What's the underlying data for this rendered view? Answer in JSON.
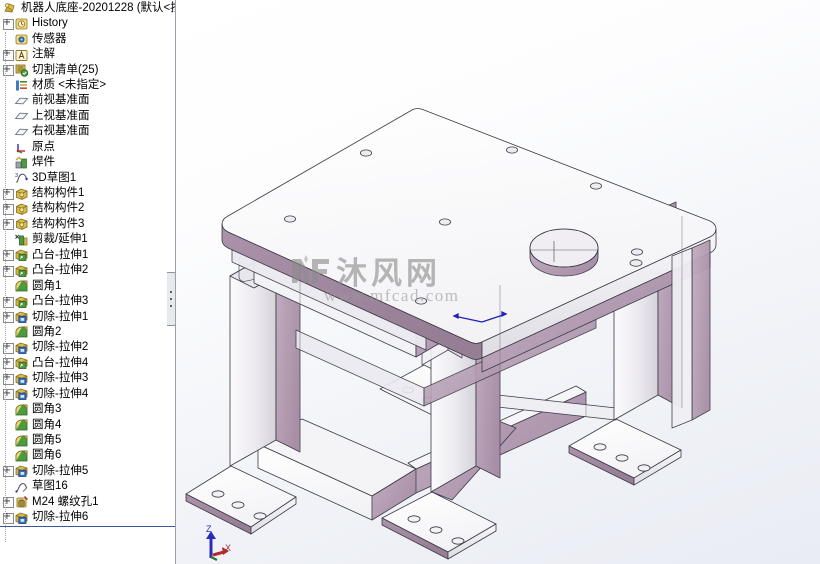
{
  "window": {
    "title": "机器人底座-20201228 (默认<按",
    "root_icon": "part-document-icon"
  },
  "tree": {
    "panel_name": "feature-manager-design-tree",
    "items": [
      {
        "label": "History",
        "icon": "history-icon",
        "expandable": true,
        "indent": 1
      },
      {
        "label": "传感器",
        "icon": "sensors-icon",
        "expandable": false,
        "indent": 1
      },
      {
        "label": "注解",
        "icon": "annotations-icon",
        "expandable": true,
        "indent": 1
      },
      {
        "label": "切割清单(25)",
        "icon": "cut-list-icon",
        "expandable": true,
        "indent": 1
      },
      {
        "label": "材质 <未指定>",
        "icon": "material-icon",
        "expandable": false,
        "indent": 1
      },
      {
        "label": "前视基准面",
        "icon": "plane-icon",
        "expandable": false,
        "indent": 1
      },
      {
        "label": "上视基准面",
        "icon": "plane-icon",
        "expandable": false,
        "indent": 1
      },
      {
        "label": "右视基准面",
        "icon": "plane-icon",
        "expandable": false,
        "indent": 1
      },
      {
        "label": "原点",
        "icon": "origin-icon",
        "expandable": false,
        "indent": 1
      },
      {
        "label": "焊件",
        "icon": "weldment-icon",
        "expandable": false,
        "indent": 1
      },
      {
        "label": "3D草图1",
        "icon": "sketch3d-icon",
        "expandable": false,
        "indent": 1
      },
      {
        "label": "结构构件1",
        "icon": "structural-member-icon",
        "expandable": true,
        "indent": 1
      },
      {
        "label": "结构构件2",
        "icon": "structural-member-icon",
        "expandable": true,
        "indent": 1
      },
      {
        "label": "结构构件3",
        "icon": "structural-member-icon",
        "expandable": true,
        "indent": 1
      },
      {
        "label": "剪裁/延伸1",
        "icon": "trim-extend-icon",
        "expandable": false,
        "indent": 1
      },
      {
        "label": "凸台-拉伸1",
        "icon": "boss-extrude-icon",
        "expandable": true,
        "indent": 1
      },
      {
        "label": "凸台-拉伸2",
        "icon": "boss-extrude-icon",
        "expandable": true,
        "indent": 1
      },
      {
        "label": "圆角1",
        "icon": "fillet-icon",
        "expandable": false,
        "indent": 1
      },
      {
        "label": "凸台-拉伸3",
        "icon": "boss-extrude-icon",
        "expandable": true,
        "indent": 1
      },
      {
        "label": "切除-拉伸1",
        "icon": "cut-extrude-icon",
        "expandable": true,
        "indent": 1
      },
      {
        "label": "圆角2",
        "icon": "fillet-icon",
        "expandable": false,
        "indent": 1
      },
      {
        "label": "切除-拉伸2",
        "icon": "cut-extrude-icon",
        "expandable": true,
        "indent": 1
      },
      {
        "label": "凸台-拉伸4",
        "icon": "boss-extrude-icon",
        "expandable": true,
        "indent": 1
      },
      {
        "label": "切除-拉伸3",
        "icon": "cut-extrude-icon",
        "expandable": true,
        "indent": 1
      },
      {
        "label": "切除-拉伸4",
        "icon": "cut-extrude-icon",
        "expandable": true,
        "indent": 1
      },
      {
        "label": "圆角3",
        "icon": "fillet-icon",
        "expandable": false,
        "indent": 1
      },
      {
        "label": "圆角4",
        "icon": "fillet-icon",
        "expandable": false,
        "indent": 1
      },
      {
        "label": "圆角5",
        "icon": "fillet-icon",
        "expandable": false,
        "indent": 1
      },
      {
        "label": "圆角6",
        "icon": "fillet-icon",
        "expandable": false,
        "indent": 1
      },
      {
        "label": "切除-拉伸5",
        "icon": "cut-extrude-icon",
        "expandable": true,
        "indent": 1
      },
      {
        "label": "草图16",
        "icon": "sketch-icon",
        "expandable": false,
        "indent": 1
      },
      {
        "label": "M24 螺纹孔1",
        "icon": "hole-wizard-icon",
        "expandable": true,
        "indent": 1
      },
      {
        "label": "切除-拉伸6",
        "icon": "cut-extrude-icon",
        "expandable": true,
        "indent": 1
      }
    ]
  },
  "viewport": {
    "name": "graphics-area",
    "watermark_cjk": "沐风网",
    "watermark_url": "www.mfcad.com",
    "axis": {
      "z": "Z",
      "x": "X",
      "y": "Y"
    },
    "background_top": "#ffffff",
    "background_bottom": "#e9ecf3",
    "model_face_light": "#fdfdfd",
    "model_face_mid": "#e6e4ea",
    "model_face_mauve": "#b49db3",
    "model_face_mauve_dark": "#9c849c",
    "model_edge": "#3a3a44"
  },
  "colors": {
    "tree_divider": "#3c5a9a",
    "panel_border": "#9aa0ac",
    "icon_gold": "#d7bb4e",
    "icon_green": "#4e9a3e",
    "icon_blue": "#3a5fa8"
  }
}
